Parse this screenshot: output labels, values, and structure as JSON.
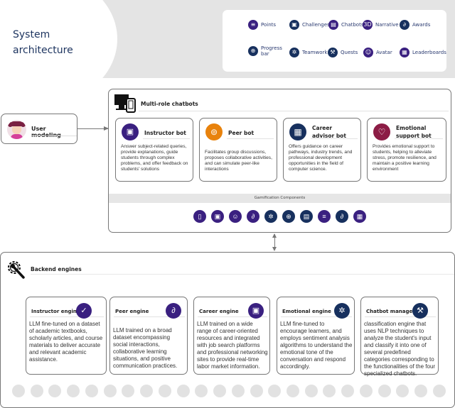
{
  "title": {
    "line1": "System",
    "line2": "architecture"
  },
  "gamification_panel": {
    "items": [
      {
        "label": "Points",
        "icon": "points-icon"
      },
      {
        "label": "Challenges",
        "icon": "challenges-icon"
      },
      {
        "label": "Chatbots",
        "icon": "chatbots-icon"
      },
      {
        "label": "Narrative",
        "icon": "narrative-icon"
      },
      {
        "label": "Awards",
        "icon": "awards-icon"
      },
      {
        "label": "Progress bar",
        "icon": "progress-bar-icon"
      },
      {
        "label": "Teamwork",
        "icon": "teamwork-icon"
      },
      {
        "label": "Quests",
        "icon": "quests-icon"
      },
      {
        "label": "Avatar",
        "icon": "avatar-icon"
      },
      {
        "label": "Leaderboards",
        "icon": "leaderboards-icon"
      }
    ]
  },
  "user_modeling": {
    "label": "User modeling"
  },
  "chatbots": {
    "title": "Multi-role chatbots",
    "bots": [
      {
        "title": "Instructor bot",
        "color": "#3a2080",
        "description": "Answer subject-related queries, provide explanations, guide students through complex problems, and offer feedback on students' solutions"
      },
      {
        "title": "Peer bot",
        "color": "#e8820c",
        "description": "Facilitates group discussions, proposes collaborative activities, and can simulate peer-like interactions"
      },
      {
        "title": "Career advisor bot",
        "color": "#17305e",
        "description": "Offers guidance on career pathways, industry trends, and professional development opportunities in the field of computer science."
      },
      {
        "title": "Emotional support bot",
        "color": "#8c1c45",
        "description": "Provides emotional support to students, helping to alleviate stress, promote resilience, and maintain a positive learning environment"
      }
    ],
    "gamification_label": "Gamification Components",
    "components": [
      "phone-icon",
      "slides-icon",
      "avatar-icon",
      "tools-icon",
      "teamwork-icon",
      "progress-bar-icon",
      "code-window-icon",
      "points-icon",
      "awards-icon",
      "leaderboards-icon"
    ]
  },
  "backend": {
    "title": "Backend engines",
    "engines": [
      {
        "title": "Instructor engine",
        "color": "#3a2080",
        "description": "LLM fine-tuned on a dataset of academic textbooks, scholarly articles, and course materials to deliver accurate and relevant academic assistance."
      },
      {
        "title": "Peer engine",
        "color": "#3a2080",
        "description": "LLM trained on a broad dataset encompassing social interactions, collaborative learning situations, and positive communication practices."
      },
      {
        "title": "Career engine",
        "color": "#3a2080",
        "description": "LLM trained on a wide range of career-oriented resources and integrated with job search platforms and professional networking sites to provide real-time labor market information."
      },
      {
        "title": "Emotional engine",
        "color": "#17305e",
        "description": "LLM fine-tuned to encourage learners, and employs sentiment analysis algorithms to understand the emotional tone of the conversation and respond accordingly."
      },
      {
        "title": "Chatbot manager",
        "color": "#17305e",
        "description": "classification engine that uses NLP techniques to analyze the student's input and classify it into one of several predefined categories corresponding to the functionalities of the four specialized chatbots."
      }
    ]
  }
}
